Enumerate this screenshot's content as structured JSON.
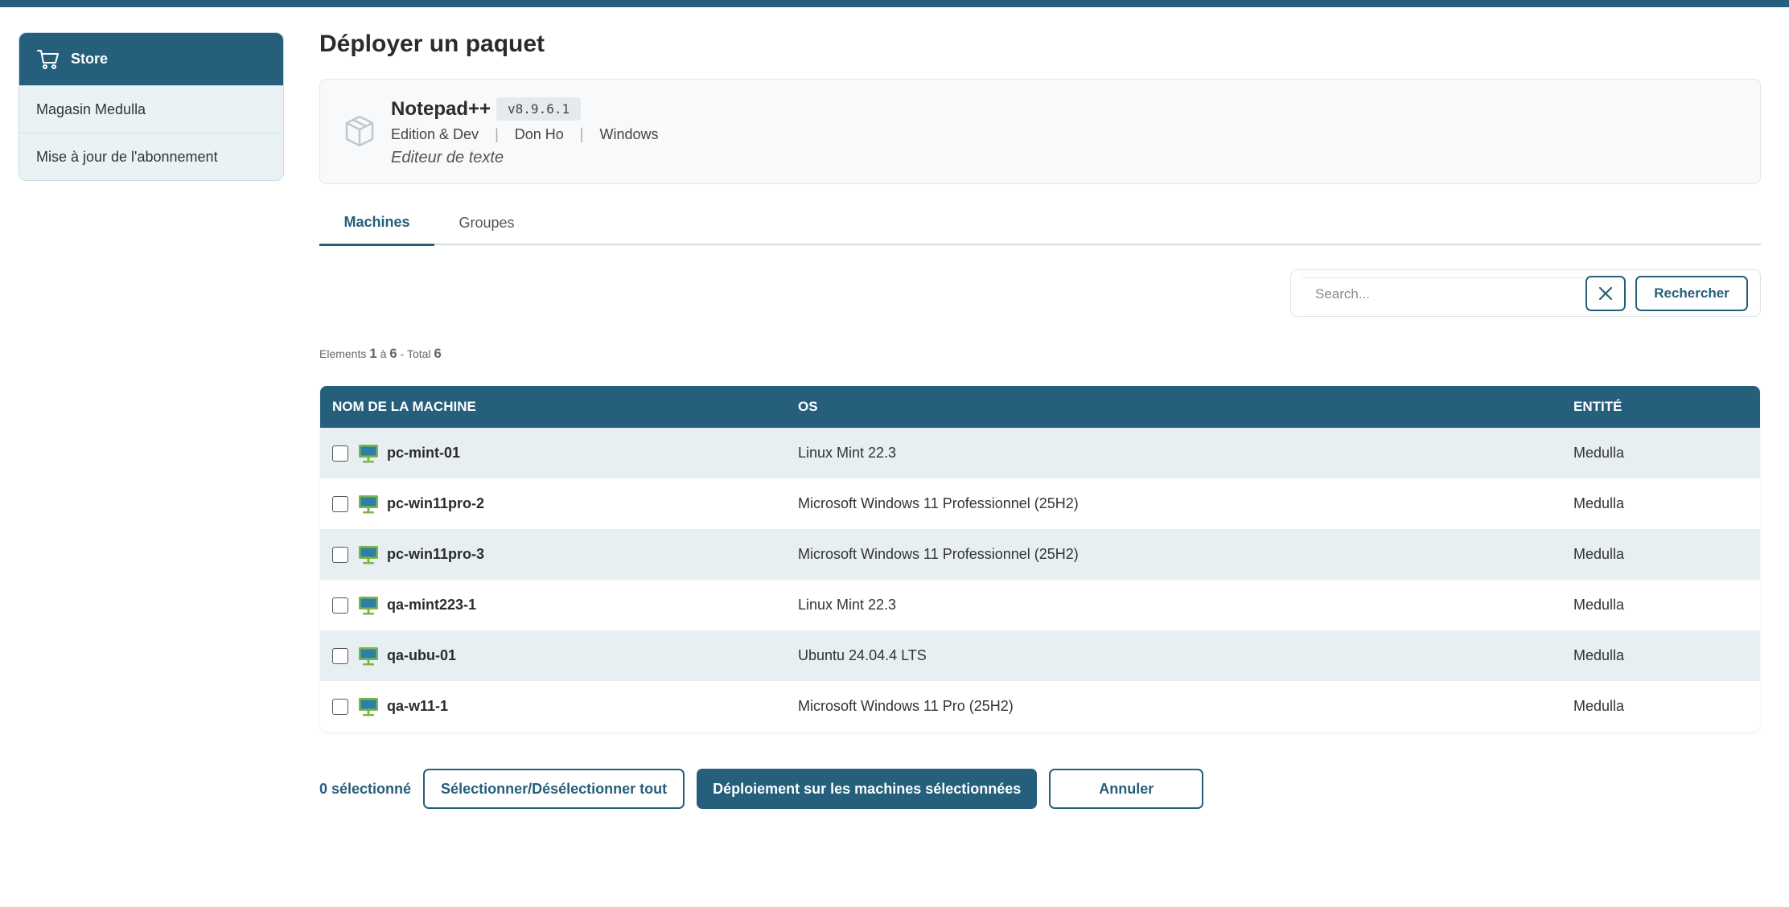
{
  "sidebar": {
    "header": "Store",
    "items": [
      {
        "label": "Magasin Medulla"
      },
      {
        "label": "Mise à jour de l'abonnement"
      }
    ]
  },
  "page": {
    "title": "Déployer un paquet"
  },
  "package": {
    "name": "Notepad++",
    "version": "v8.9.6.1",
    "category": "Edition & Dev",
    "sep": "|",
    "vendor": "Don Ho",
    "platform": "Windows",
    "description": "Editeur de texte"
  },
  "tabs": [
    {
      "label": "Machines",
      "active": true
    },
    {
      "label": "Groupes",
      "active": false
    }
  ],
  "search": {
    "placeholder": "Search...",
    "value": "",
    "button_label": "Rechercher"
  },
  "pagination": {
    "prefix": "Elements",
    "from": "1",
    "to_word": "à",
    "to": "6",
    "total_word": "- Total",
    "total": "6"
  },
  "table": {
    "headers": [
      "Nom de la machine",
      "OS",
      "Entité"
    ],
    "rows": [
      {
        "name": "pc-mint-01",
        "os": "Linux Mint 22.3",
        "entity": "Medulla"
      },
      {
        "name": "pc-win11pro-2",
        "os": "Microsoft Windows 11 Professionnel (25H2)",
        "entity": "Medulla"
      },
      {
        "name": "pc-win11pro-3",
        "os": "Microsoft Windows 11 Professionnel (25H2)",
        "entity": "Medulla"
      },
      {
        "name": "qa-mint223-1",
        "os": "Linux Mint 22.3",
        "entity": "Medulla"
      },
      {
        "name": "qa-ubu-01",
        "os": "Ubuntu 24.04.4 LTS",
        "entity": "Medulla"
      },
      {
        "name": "qa-w11-1",
        "os": "Microsoft Windows 11 Pro (25H2)",
        "entity": "Medulla"
      }
    ]
  },
  "footer": {
    "selected_count": "0 sélectionné",
    "toggle_all_label": "Sélectionner/Désélectionner tout",
    "deploy_label": "Déploiement sur les machines sélectionnées",
    "cancel_label": "Annuler"
  },
  "colors": {
    "primary": "#255f7c",
    "row_alt": "#e7eff2",
    "monitor_green": "#7ab648",
    "monitor_screen": "#2d7fa8"
  },
  "icons": {
    "sidebar_header": "cart-icon",
    "package": "package-box-icon",
    "clear": "close-icon",
    "machine": "desktop-monitor-icon"
  }
}
